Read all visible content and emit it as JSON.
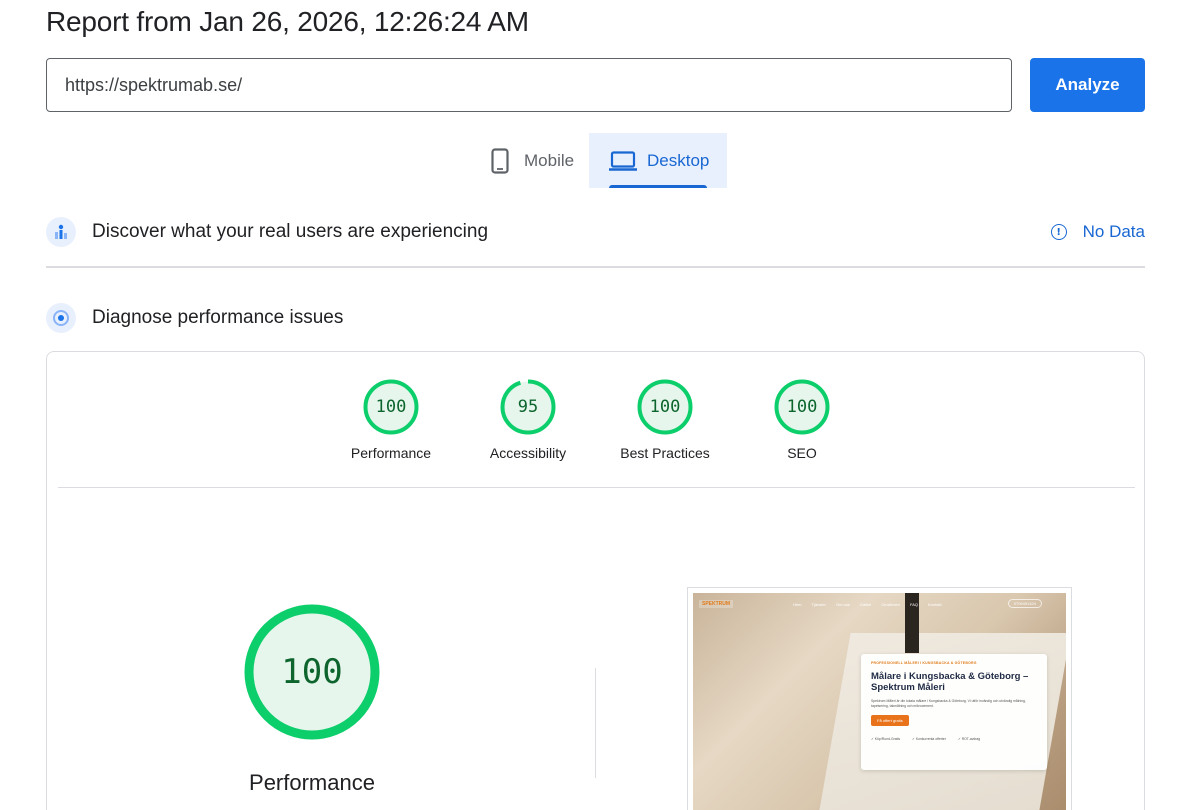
{
  "header": {
    "title": "Report from Jan 26, 2026, 12:26:24 AM"
  },
  "search": {
    "url_value": "https://spektrumab.se/",
    "analyze_label": "Analyze"
  },
  "tabs": [
    {
      "label": "Mobile",
      "icon": "phone-icon",
      "active": false
    },
    {
      "label": "Desktop",
      "icon": "laptop-icon",
      "active": true
    }
  ],
  "field_data": {
    "title": "Discover what your real users are experiencing",
    "status": "No Data",
    "icon": "users-chart-icon"
  },
  "lab": {
    "title": "Diagnose performance issues",
    "icon": "target-icon",
    "categories": [
      {
        "label": "Performance",
        "score": "100",
        "value": 100
      },
      {
        "label": "Accessibility",
        "score": "95",
        "value": 95
      },
      {
        "label": "Best Practices",
        "score": "100",
        "value": 100
      },
      {
        "label": "SEO",
        "score": "100",
        "value": 100
      }
    ],
    "main_score": {
      "label": "Performance",
      "score": "100",
      "value": 100
    }
  },
  "colors": {
    "accent": "#1a73e8",
    "pass": "#0cce6b",
    "pass_bg": "#e6f6ec",
    "pass_text": "#0d652d"
  },
  "site_preview": {
    "logo": "SPEKTRUM",
    "nav_links": [
      "Hem",
      "Tjänster",
      "Om oss",
      "Galleri",
      "Omdömen",
      "FAQ",
      "Kontakt"
    ],
    "phone": "0709491424",
    "kicker": "PROFESSIONELL MÅLERI I KUNGSBACKA & GÖTEBORG",
    "headline": "Målare i Kungsbacka & Göteborg – Spektrum Måleri",
    "body": "Spektrum Måleri är din lokala målare i Kungsbacka & Göteborg. Vi utför invändig och utvändig målning, tapetsering, takmålning och mikrocement.",
    "cta": "Få offert gratis",
    "checks": [
      "Köp/Rund-Gratis",
      "Konkurrenta offerter",
      "ROT-avdrag"
    ]
  }
}
